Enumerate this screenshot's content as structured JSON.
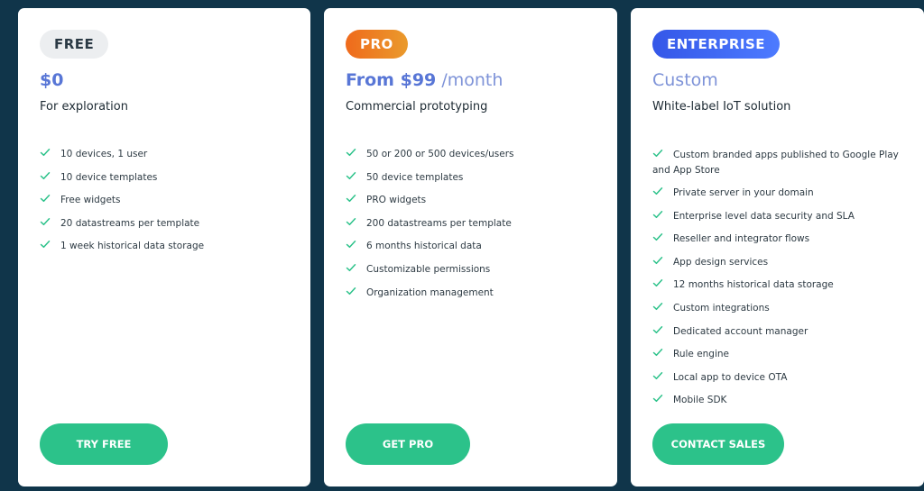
{
  "colors": {
    "background": "#10354a",
    "accent_green": "#2cc28a",
    "price_blue": "#5876d6",
    "check_green": "#2cc28a"
  },
  "plans": [
    {
      "badge": "FREE",
      "price_main": "$0",
      "price_suffix": "",
      "subtitle": "For exploration",
      "features": [
        "10 devices, 1 user",
        "10 device templates",
        "Free widgets",
        "20 datastreams per template",
        "1 week historical data storage"
      ],
      "cta": "TRY FREE"
    },
    {
      "badge": "PRO",
      "price_main": "From $99",
      "price_suffix": "/month",
      "subtitle": "Commercial prototyping",
      "features": [
        "50 or 200 or 500 devices/users",
        "50 device templates",
        "PRO widgets",
        "200 datastreams per template",
        "6 months historical data",
        "Customizable permissions",
        "Organization management"
      ],
      "cta": "GET PRO"
    },
    {
      "badge": "ENTERPRISE",
      "price_main": "Custom",
      "price_suffix": "",
      "subtitle": "White-label IoT solution",
      "features": [
        "Custom branded apps published to Google Play and App Store",
        "Private server in your domain",
        "Enterprise level data security and SLA",
        "Reseller and integrator flows",
        "App design services",
        "12 months historical data storage",
        "Custom integrations",
        "Dedicated account manager",
        "Rule engine",
        "Local app to device OTA",
        "Mobile SDK"
      ],
      "cta": "CONTACT SALES"
    }
  ],
  "icons": {
    "feature_bullet": "check-icon"
  }
}
